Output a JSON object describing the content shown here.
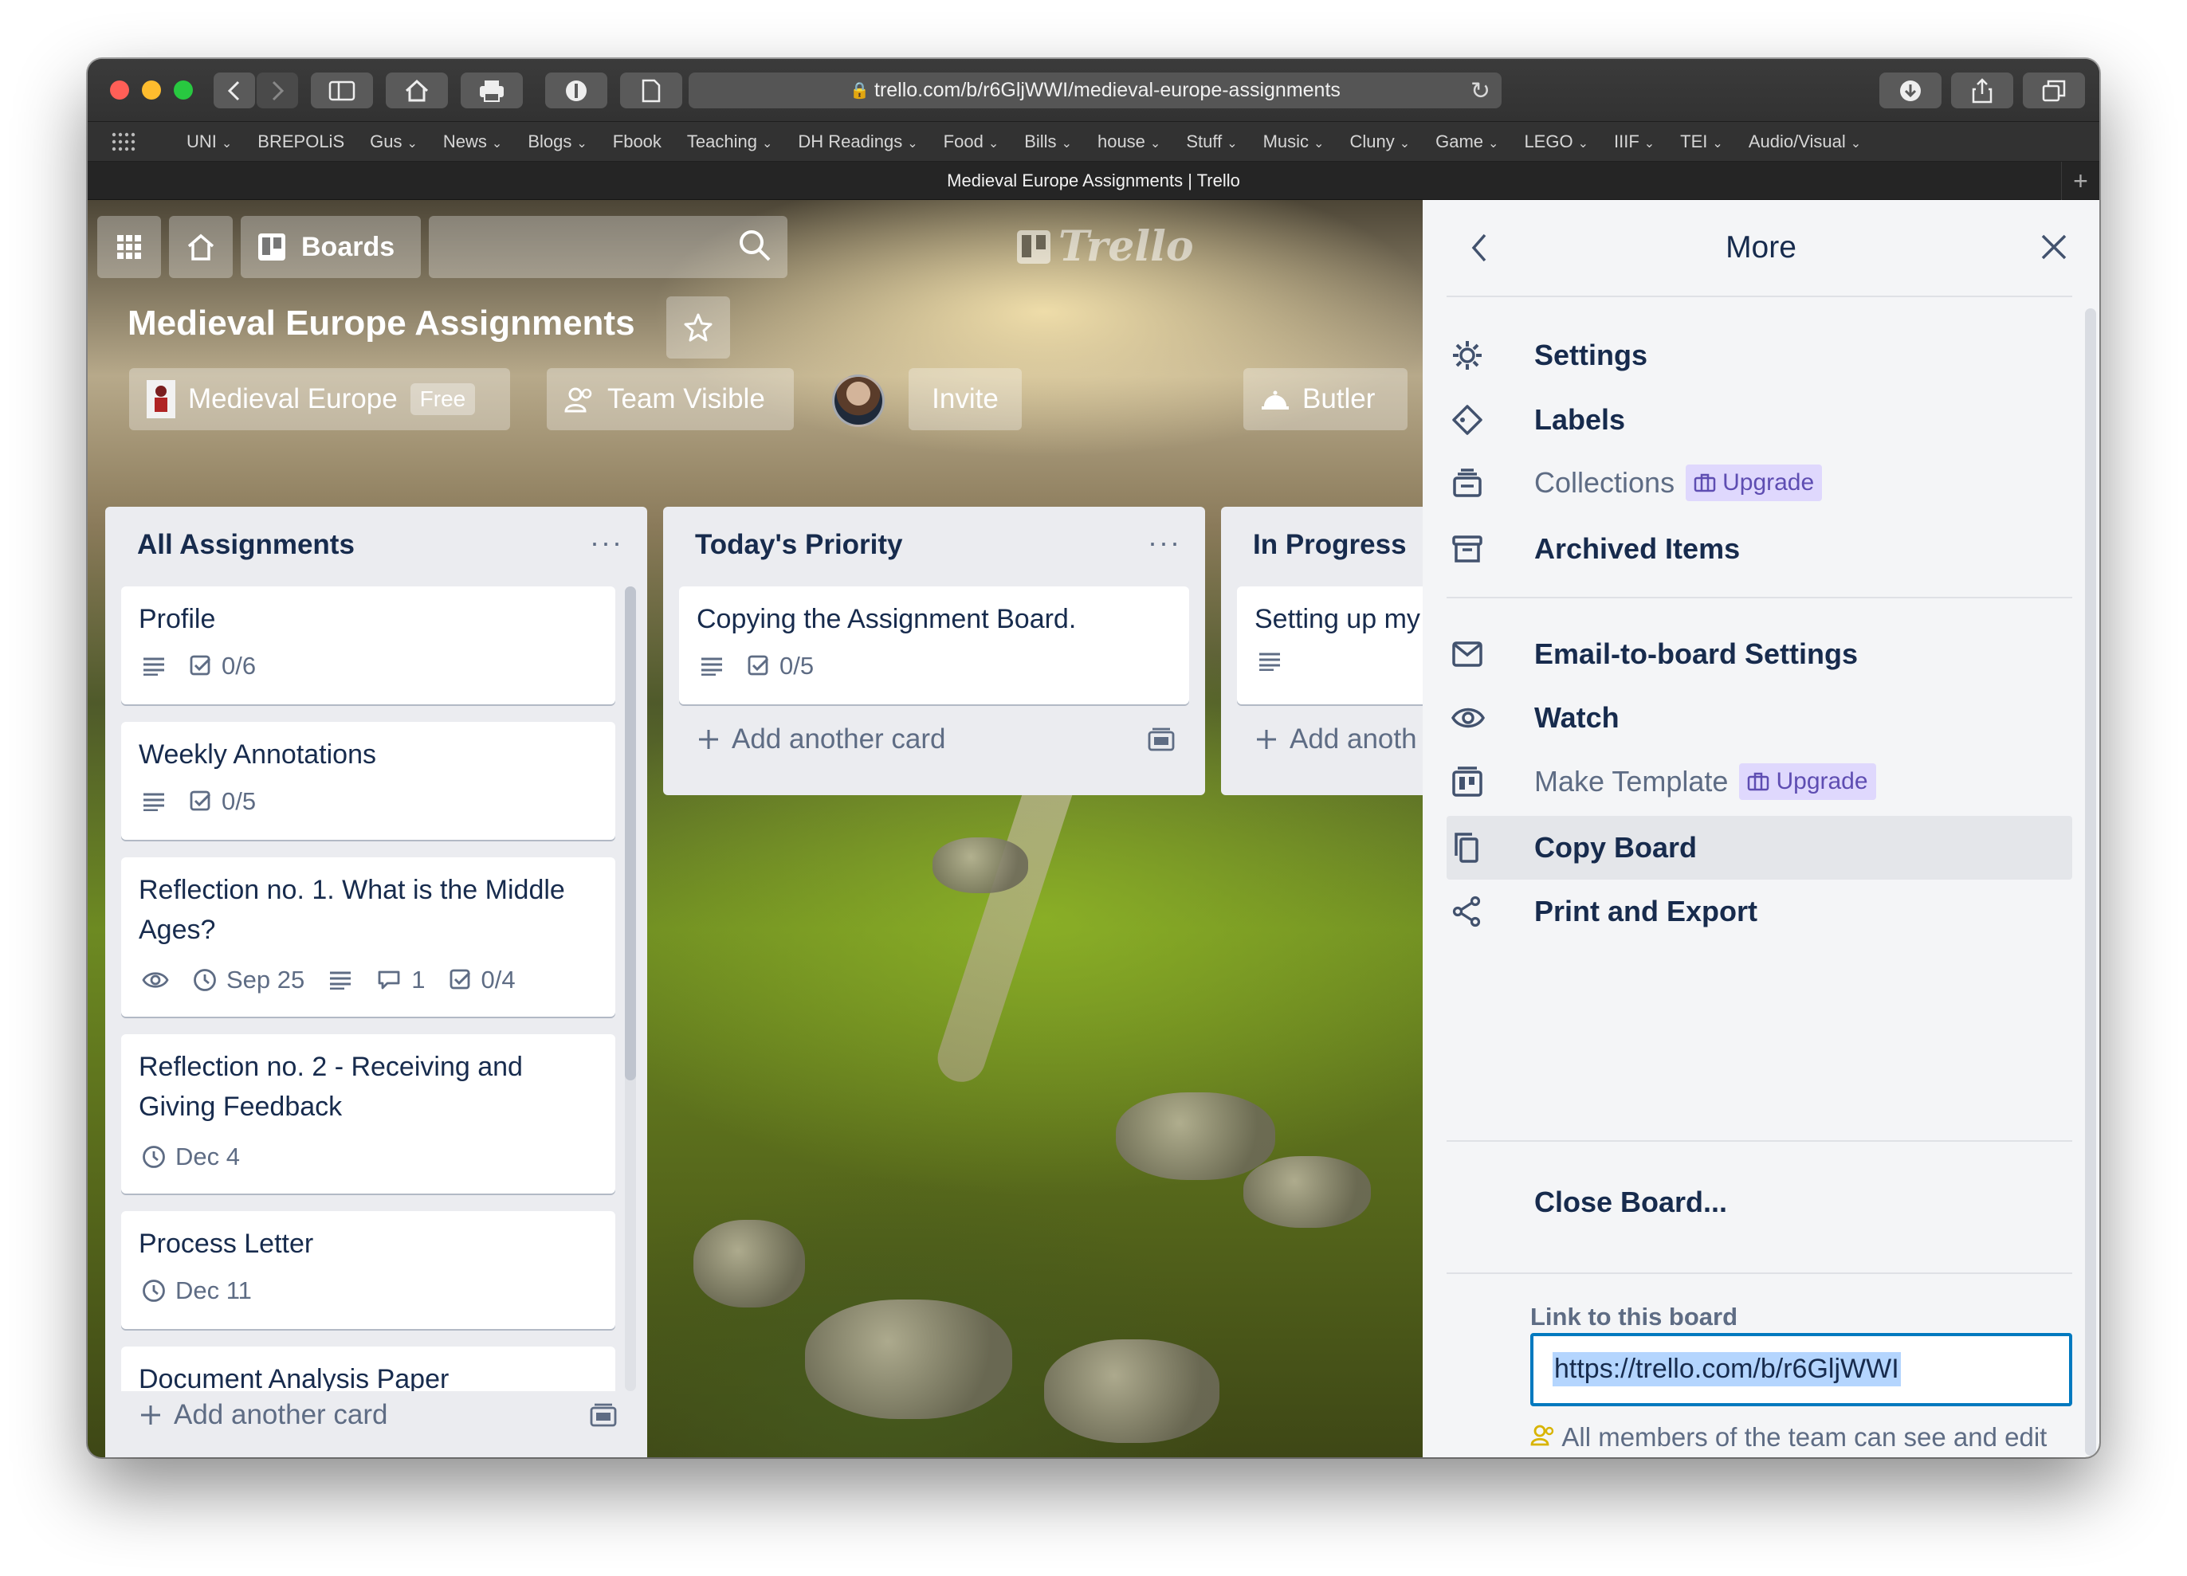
{
  "browser": {
    "url": "trello.com/b/r6GljWWI/medieval-europe-assignments",
    "tab_title": "Medieval Europe Assignments | Trello",
    "bookmarks": [
      "UNI",
      "BREPOLiS",
      "Gus",
      "News",
      "Blogs",
      "Fbook",
      "Teaching",
      "DH Readings",
      "Food",
      "Bills",
      "house",
      "Stuff",
      "Music",
      "Cluny",
      "Game",
      "LEGO",
      "IIIF",
      "TEI",
      "Audio/Visual"
    ],
    "bookmark_has_dropdown": [
      true,
      false,
      true,
      true,
      true,
      false,
      true,
      true,
      true,
      true,
      true,
      true,
      true,
      true,
      true,
      true,
      true,
      true,
      true
    ],
    "traffic_lights": [
      "#ff5f57",
      "#febc2e",
      "#28c840"
    ]
  },
  "nav": {
    "boards_label": "Boards",
    "logo_text": "Trello"
  },
  "board": {
    "title": "Medieval Europe Assignments",
    "team_name": "Medieval Europe",
    "team_plan": "Free",
    "visibility": "Team Visible",
    "invite_label": "Invite",
    "butler_label": "Butler"
  },
  "lists": [
    {
      "name": "All Assignments",
      "cards": [
        {
          "title_lines": [
            "Profile"
          ],
          "badges": [
            {
              "icon": "description-icon",
              "text": ""
            },
            {
              "icon": "checklist-icon",
              "text": "0/6"
            }
          ]
        },
        {
          "title_lines": [
            "Weekly Annotations"
          ],
          "badges": [
            {
              "icon": "description-icon",
              "text": ""
            },
            {
              "icon": "checklist-icon",
              "text": "0/5"
            }
          ]
        },
        {
          "title_lines": [
            "Reflection no. 1. What is the Middle",
            "Ages?"
          ],
          "badges": [
            {
              "icon": "watch-icon",
              "text": ""
            },
            {
              "icon": "clock-icon",
              "text": "Sep 25"
            },
            {
              "icon": "description-icon",
              "text": ""
            },
            {
              "icon": "comment-icon",
              "text": "1"
            },
            {
              "icon": "checklist-icon",
              "text": "0/4"
            }
          ]
        },
        {
          "title_lines": [
            "Reflection no. 2 - Receiving and",
            "Giving Feedback"
          ],
          "badges": [
            {
              "icon": "clock-icon",
              "text": "Dec 4"
            }
          ]
        },
        {
          "title_lines": [
            "Process Letter"
          ],
          "badges": [
            {
              "icon": "clock-icon",
              "text": "Dec 11"
            }
          ]
        },
        {
          "title_lines": [
            "Document Analysis Paper"
          ],
          "badges": []
        }
      ],
      "add_card_label": "Add another card"
    },
    {
      "name": "Today's Priority",
      "cards": [
        {
          "title_lines": [
            "Copying the Assignment Board."
          ],
          "badges": [
            {
              "icon": "description-icon",
              "text": ""
            },
            {
              "icon": "checklist-icon",
              "text": "0/5"
            }
          ]
        }
      ],
      "add_card_label": "Add another card"
    },
    {
      "name": "In Progress",
      "cards": [
        {
          "title_lines": [
            "Setting up my"
          ],
          "badges": [
            {
              "icon": "description-icon",
              "text": ""
            }
          ]
        }
      ],
      "add_card_label": "Add anoth"
    }
  ],
  "menu": {
    "title": "More",
    "items": [
      {
        "label": "Settings",
        "icon": "gear-icon"
      },
      {
        "label": "Labels",
        "icon": "tag-icon"
      },
      {
        "label": "Collections",
        "icon": "collection-icon",
        "upgrade": "Upgrade"
      },
      {
        "label": "Archived Items",
        "icon": "archive-icon"
      },
      {
        "label": "Email-to-board Settings",
        "icon": "email-icon"
      },
      {
        "label": "Watch",
        "icon": "eye-icon"
      },
      {
        "label": "Make Template",
        "icon": "template-icon",
        "upgrade": "Upgrade"
      },
      {
        "label": "Copy Board",
        "icon": "copy-icon"
      },
      {
        "label": "Print and Export",
        "icon": "share-icon"
      },
      {
        "label": "Close Board...",
        "icon": ""
      }
    ],
    "link_label": "Link to this board",
    "link_value": "https://trello.com/b/r6GljWWI",
    "note": "All members of the team can see and edit this board."
  }
}
